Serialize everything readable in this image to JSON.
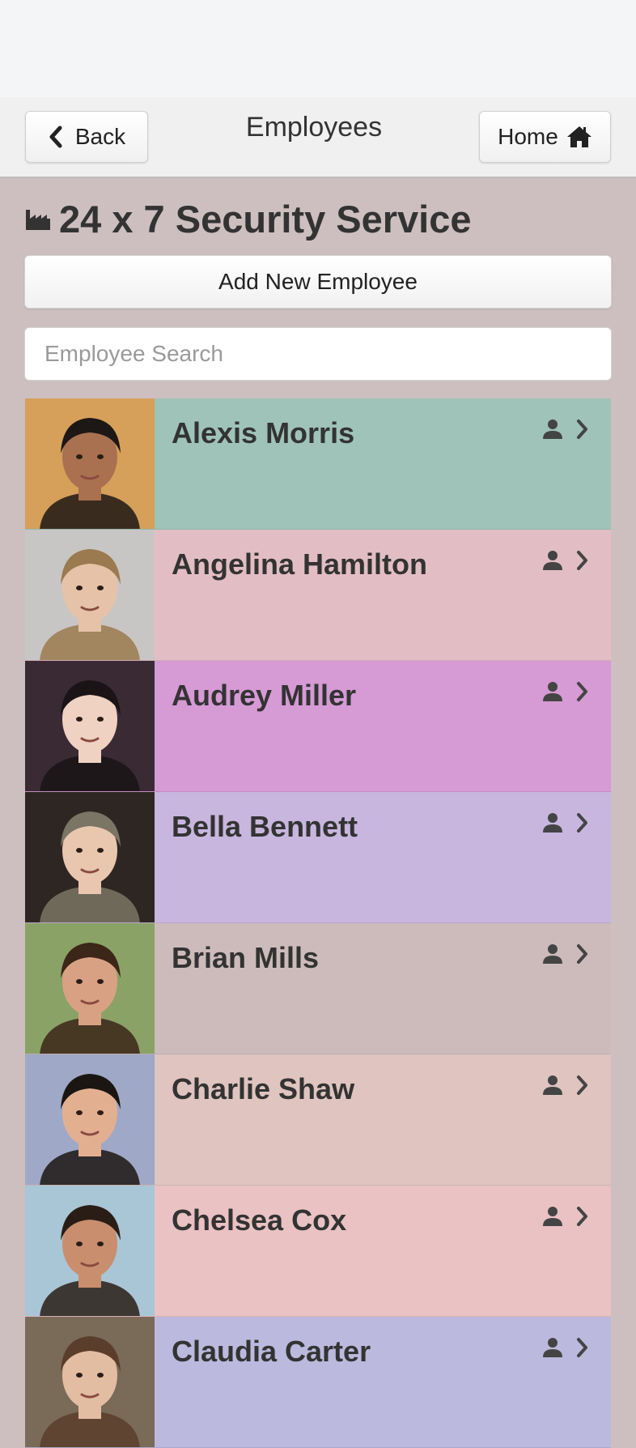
{
  "navbar": {
    "title": "Employees",
    "back_label": "Back",
    "home_label": "Home"
  },
  "company": {
    "name": "24 x 7 Security Service",
    "icon": "factory-icon"
  },
  "actions": {
    "add_label": "Add New Employee"
  },
  "search": {
    "placeholder": "Employee Search",
    "value": ""
  },
  "employees": [
    {
      "name": "Alexis Morris",
      "color": "#9fc3b8",
      "skin": "#a9714f",
      "hair": "#1d1715",
      "bg": "#d6a05a"
    },
    {
      "name": "Angelina Hamilton",
      "color": "#e2bec4",
      "skin": "#e6c2a8",
      "hair": "#9a7a4e",
      "bg": "#c8c6c4"
    },
    {
      "name": "Audrey Miller",
      "color": "#d69ad5",
      "skin": "#f0d2c2",
      "hair": "#1a1416",
      "bg": "#3a2a34"
    },
    {
      "name": "Bella Bennett",
      "color": "#c8b6df",
      "skin": "#e8c7ae",
      "hair": "#7a7564",
      "bg": "#2e2622"
    },
    {
      "name": "Brian Mills",
      "color": "#cdbbbc",
      "skin": "#d9a183",
      "hair": "#3b2618",
      "bg": "#8aa266"
    },
    {
      "name": "Charlie Shaw",
      "color": "#dfc4bf",
      "skin": "#e2b091",
      "hair": "#1c1612",
      "bg": "#9fa8c6"
    },
    {
      "name": "Chelsea Cox",
      "color": "#eac2c3",
      "skin": "#c98e6e",
      "hair": "#2a1d16",
      "bg": "#a9c6d6"
    },
    {
      "name": "Claudia Carter",
      "color": "#bbb9dd",
      "skin": "#e3bda2",
      "hair": "#5a3d2a",
      "bg": "#7a6a58"
    }
  ]
}
